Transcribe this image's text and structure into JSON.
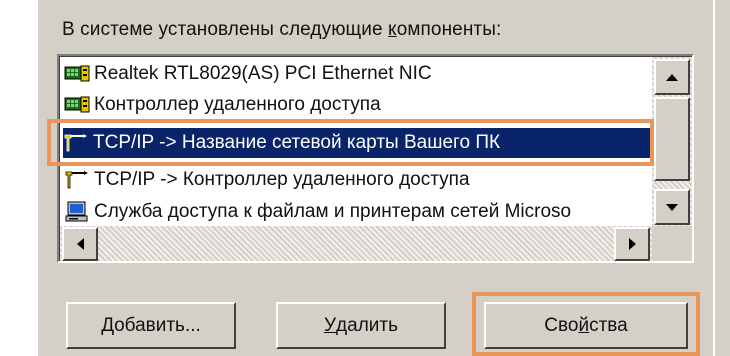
{
  "caption": {
    "before": "В системе установлены следующие ",
    "accel": "к",
    "after": "омпоненты:"
  },
  "components": [
    {
      "label": "Realtek RTL8029(AS) PCI Ethernet NIC",
      "icon": "network-adapter-icon",
      "selected": false
    },
    {
      "label": "Контроллер удаленного доступа",
      "icon": "network-adapter-icon",
      "selected": false
    },
    {
      "label": "TCP/IP -> Название сетевой карты Вашего ПК",
      "icon": "protocol-icon",
      "selected": true
    },
    {
      "label": "TCP/IP -> Контроллер удаленного доступа",
      "icon": "protocol-icon",
      "selected": false
    },
    {
      "label": "Служба доступа к файлам и принтерам сетей Microso",
      "icon": "file-printer-sharing-icon",
      "selected": false
    }
  ],
  "buttons": {
    "add": {
      "accel": "Д",
      "rest": "обавить..."
    },
    "remove": {
      "accel": "У",
      "rest": "далить"
    },
    "properties": {
      "before": "Сво",
      "accel": "й",
      "after": "ства"
    }
  },
  "colors": {
    "selection": "#0a246a",
    "highlight_outline": "#e8965a",
    "face": "#d4d0c8"
  }
}
